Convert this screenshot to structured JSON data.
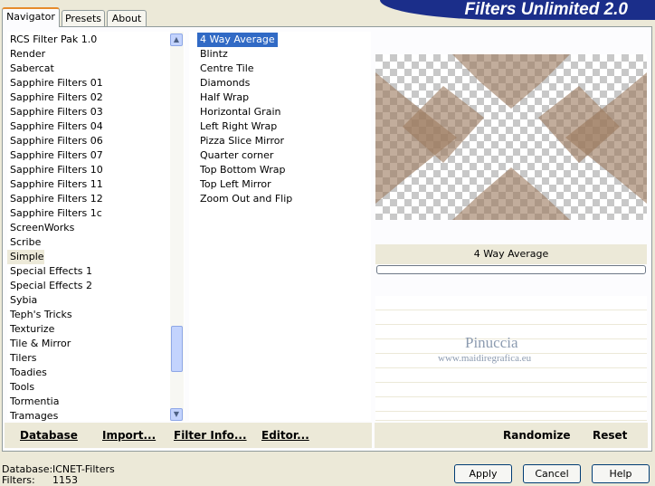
{
  "tabs": [
    {
      "label": "Navigator",
      "active": true
    },
    {
      "label": "Presets",
      "active": false
    },
    {
      "label": "About",
      "active": false
    }
  ],
  "brand": {
    "title": "Filters Unlimited 2.0"
  },
  "categories": {
    "items": [
      "RCS Filter Pak 1.0",
      "Render",
      "Sabercat",
      "Sapphire Filters 01",
      "Sapphire Filters 02",
      "Sapphire Filters 03",
      "Sapphire Filters 04",
      "Sapphire Filters 06",
      "Sapphire Filters 07",
      "Sapphire Filters 10",
      "Sapphire Filters 11",
      "Sapphire Filters 12",
      "Sapphire Filters 1c",
      "ScreenWorks",
      "Scribe",
      "Simple",
      "Special Effects 1",
      "Special Effects 2",
      "Sybia",
      "Teph's Tricks",
      "Texturize",
      "Tile & Mirror",
      "Tilers",
      "Toadies",
      "Tools",
      "Tormentia",
      "Tramages"
    ],
    "selected": "Simple"
  },
  "filters": {
    "items": [
      "4 Way Average",
      "Blintz",
      "Centre Tile",
      "Diamonds",
      "Half Wrap",
      "Horizontal Grain",
      "Left Right Wrap",
      "Pizza Slice Mirror",
      "Quarter corner",
      "Top Bottom Wrap",
      "Top Left Mirror",
      "Zoom Out and Flip"
    ],
    "selected": "4 Way Average"
  },
  "preview": {
    "filter_name": "4 Way Average"
  },
  "watermark": {
    "name": "Pinuccia",
    "url": "www.maidiregrafica.eu"
  },
  "toolbar": {
    "database": "Database",
    "import": "Import...",
    "filter_info": "Filter Info...",
    "editor": "Editor...",
    "randomize": "Randomize",
    "reset": "Reset"
  },
  "status": {
    "database_label": "Database:",
    "database_value": "ICNET-Filters",
    "filters_label": "Filters:",
    "filters_value": "1153"
  },
  "buttons": {
    "apply": "Apply",
    "cancel": "Cancel",
    "help": "Help"
  },
  "colors": {
    "brand": "#1B2E8A",
    "selection": "#316AC5",
    "dialog": "#ECE9D8",
    "tab_accent": "#E68B2C"
  }
}
